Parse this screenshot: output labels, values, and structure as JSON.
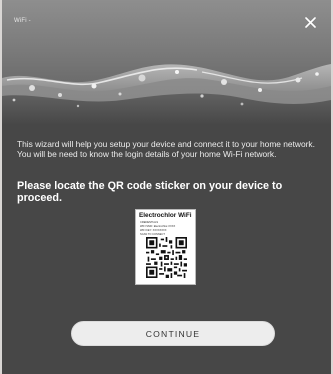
{
  "window": {
    "title": "WiFi -",
    "close_icon": "close-icon"
  },
  "content": {
    "intro": "This wizard will help you setup your device and connect it to your home network. You will be need to know the login details of your home Wi-Fi network.",
    "prompt": "Please locate the QR code sticker on your device to proceed."
  },
  "sticker": {
    "title": "Electrochlor WiFi",
    "line1": "CREDENTIALS",
    "line2": "WIFI SSID: Electrochlor-XXXX",
    "line3": "WIFI KEY: XXXXXXXX",
    "line4": "SCAN TO CONNECT"
  },
  "actions": {
    "continue_label": "CONTINUE"
  },
  "colors": {
    "panel": "#474747",
    "button_bg": "#ededed",
    "text_light": "#ececec"
  }
}
